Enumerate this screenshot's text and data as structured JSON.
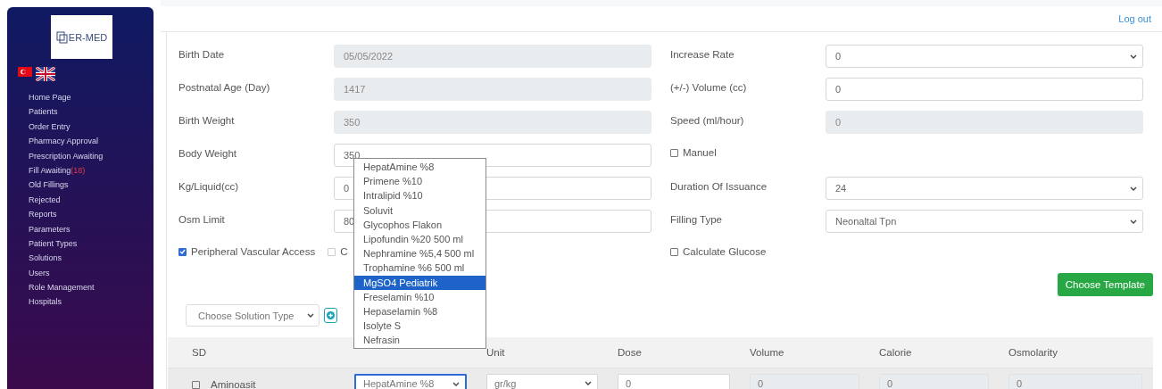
{
  "sidebar": {
    "logo": "ER-MED",
    "items": [
      {
        "label": "Home Page"
      },
      {
        "label": "Patients"
      },
      {
        "label": "Order Entry"
      },
      {
        "label": "Pharmacy Approval"
      },
      {
        "label": "Prescription Awaiting"
      },
      {
        "label": "Fill Awaiting",
        "badge": "(18)"
      },
      {
        "label": "Old Fillings"
      },
      {
        "label": "Rejected"
      },
      {
        "label": "Reports"
      },
      {
        "label": "Parameters"
      },
      {
        "label": "Patient Types"
      },
      {
        "label": "Solutions"
      },
      {
        "label": "Users"
      },
      {
        "label": "Role Management"
      },
      {
        "label": "Hospitals"
      }
    ]
  },
  "top_bar": {
    "logout": "Log out"
  },
  "left_fields": [
    {
      "kind": "input",
      "label": "Birth Date",
      "value": "05/05/2022",
      "disabled": true
    },
    {
      "kind": "input",
      "label": "Postnatal Age (Day)",
      "value": "1417",
      "disabled": true
    },
    {
      "kind": "input",
      "label": "Birth Weight",
      "value": "350",
      "disabled": true
    },
    {
      "kind": "input",
      "label": "Body Weight",
      "value": "350",
      "disabled": false
    },
    {
      "kind": "input",
      "label": "Kg/Liquid(cc)",
      "value": "0",
      "disabled": false
    },
    {
      "kind": "input",
      "label": "Osm Limit",
      "value": "80",
      "disabled": false
    },
    {
      "kind": "checkboxes",
      "items": [
        {
          "label": "Peripheral Vascular Access",
          "checked": true
        },
        {
          "label": "C",
          "checked": false
        }
      ]
    }
  ],
  "right_fields": [
    {
      "kind": "select",
      "label": "Increase Rate",
      "value": "0",
      "disabled": false
    },
    {
      "kind": "input",
      "label": "(+/-) Volume (cc)",
      "value": "0",
      "disabled": false
    },
    {
      "kind": "input",
      "label": "Speed (ml/hour)",
      "value": "0",
      "disabled": true
    },
    {
      "kind": "checkboxes",
      "items": [
        {
          "label": "Manuel",
          "checked": false
        }
      ]
    },
    {
      "kind": "select",
      "label": "Duration Of Issuance",
      "value": "24",
      "disabled": false
    },
    {
      "kind": "select",
      "label": "Filling Type",
      "value": "Neonaltal Tpn",
      "disabled": false
    },
    {
      "kind": "checkboxes",
      "items": [
        {
          "label": "Calculate Glucose",
          "checked": false
        }
      ]
    }
  ],
  "choose_template": "Choose Template",
  "solution_type": {
    "placeholder": "Choose Solution Type"
  },
  "table": {
    "columns": [
      "SD",
      "",
      "Unit",
      "Dose",
      "Volume",
      "Calorie",
      "Osmolarity"
    ],
    "rows": [
      {
        "checked": false,
        "name": "Aminoasit",
        "solution": "HepatAmine %8",
        "unit": "gr/kg",
        "dose": "0",
        "volume": "0",
        "calorie": "0",
        "osmolarity": "0"
      }
    ]
  },
  "dropdown": {
    "options": [
      {
        "label": "HepatAmine %8",
        "selected": false
      },
      {
        "label": "Primene %10",
        "selected": false
      },
      {
        "label": "Intralipid %10",
        "selected": false
      },
      {
        "label": "Soluvit",
        "selected": false
      },
      {
        "label": "Glycophos Flakon",
        "selected": false
      },
      {
        "label": "Lipofundin %20 500 ml",
        "selected": false
      },
      {
        "label": "Nephramine %5,4 500 ml",
        "selected": false
      },
      {
        "label": "Trophamine %6 500 ml",
        "selected": false
      },
      {
        "label": "MgSO4 Pediatrik",
        "selected": true
      },
      {
        "label": "Freselamin %10",
        "selected": false
      },
      {
        "label": "Hepaselamin %8",
        "selected": false
      },
      {
        "label": "Isolyte S",
        "selected": false
      },
      {
        "label": "Nefrasin",
        "selected": false
      }
    ]
  }
}
